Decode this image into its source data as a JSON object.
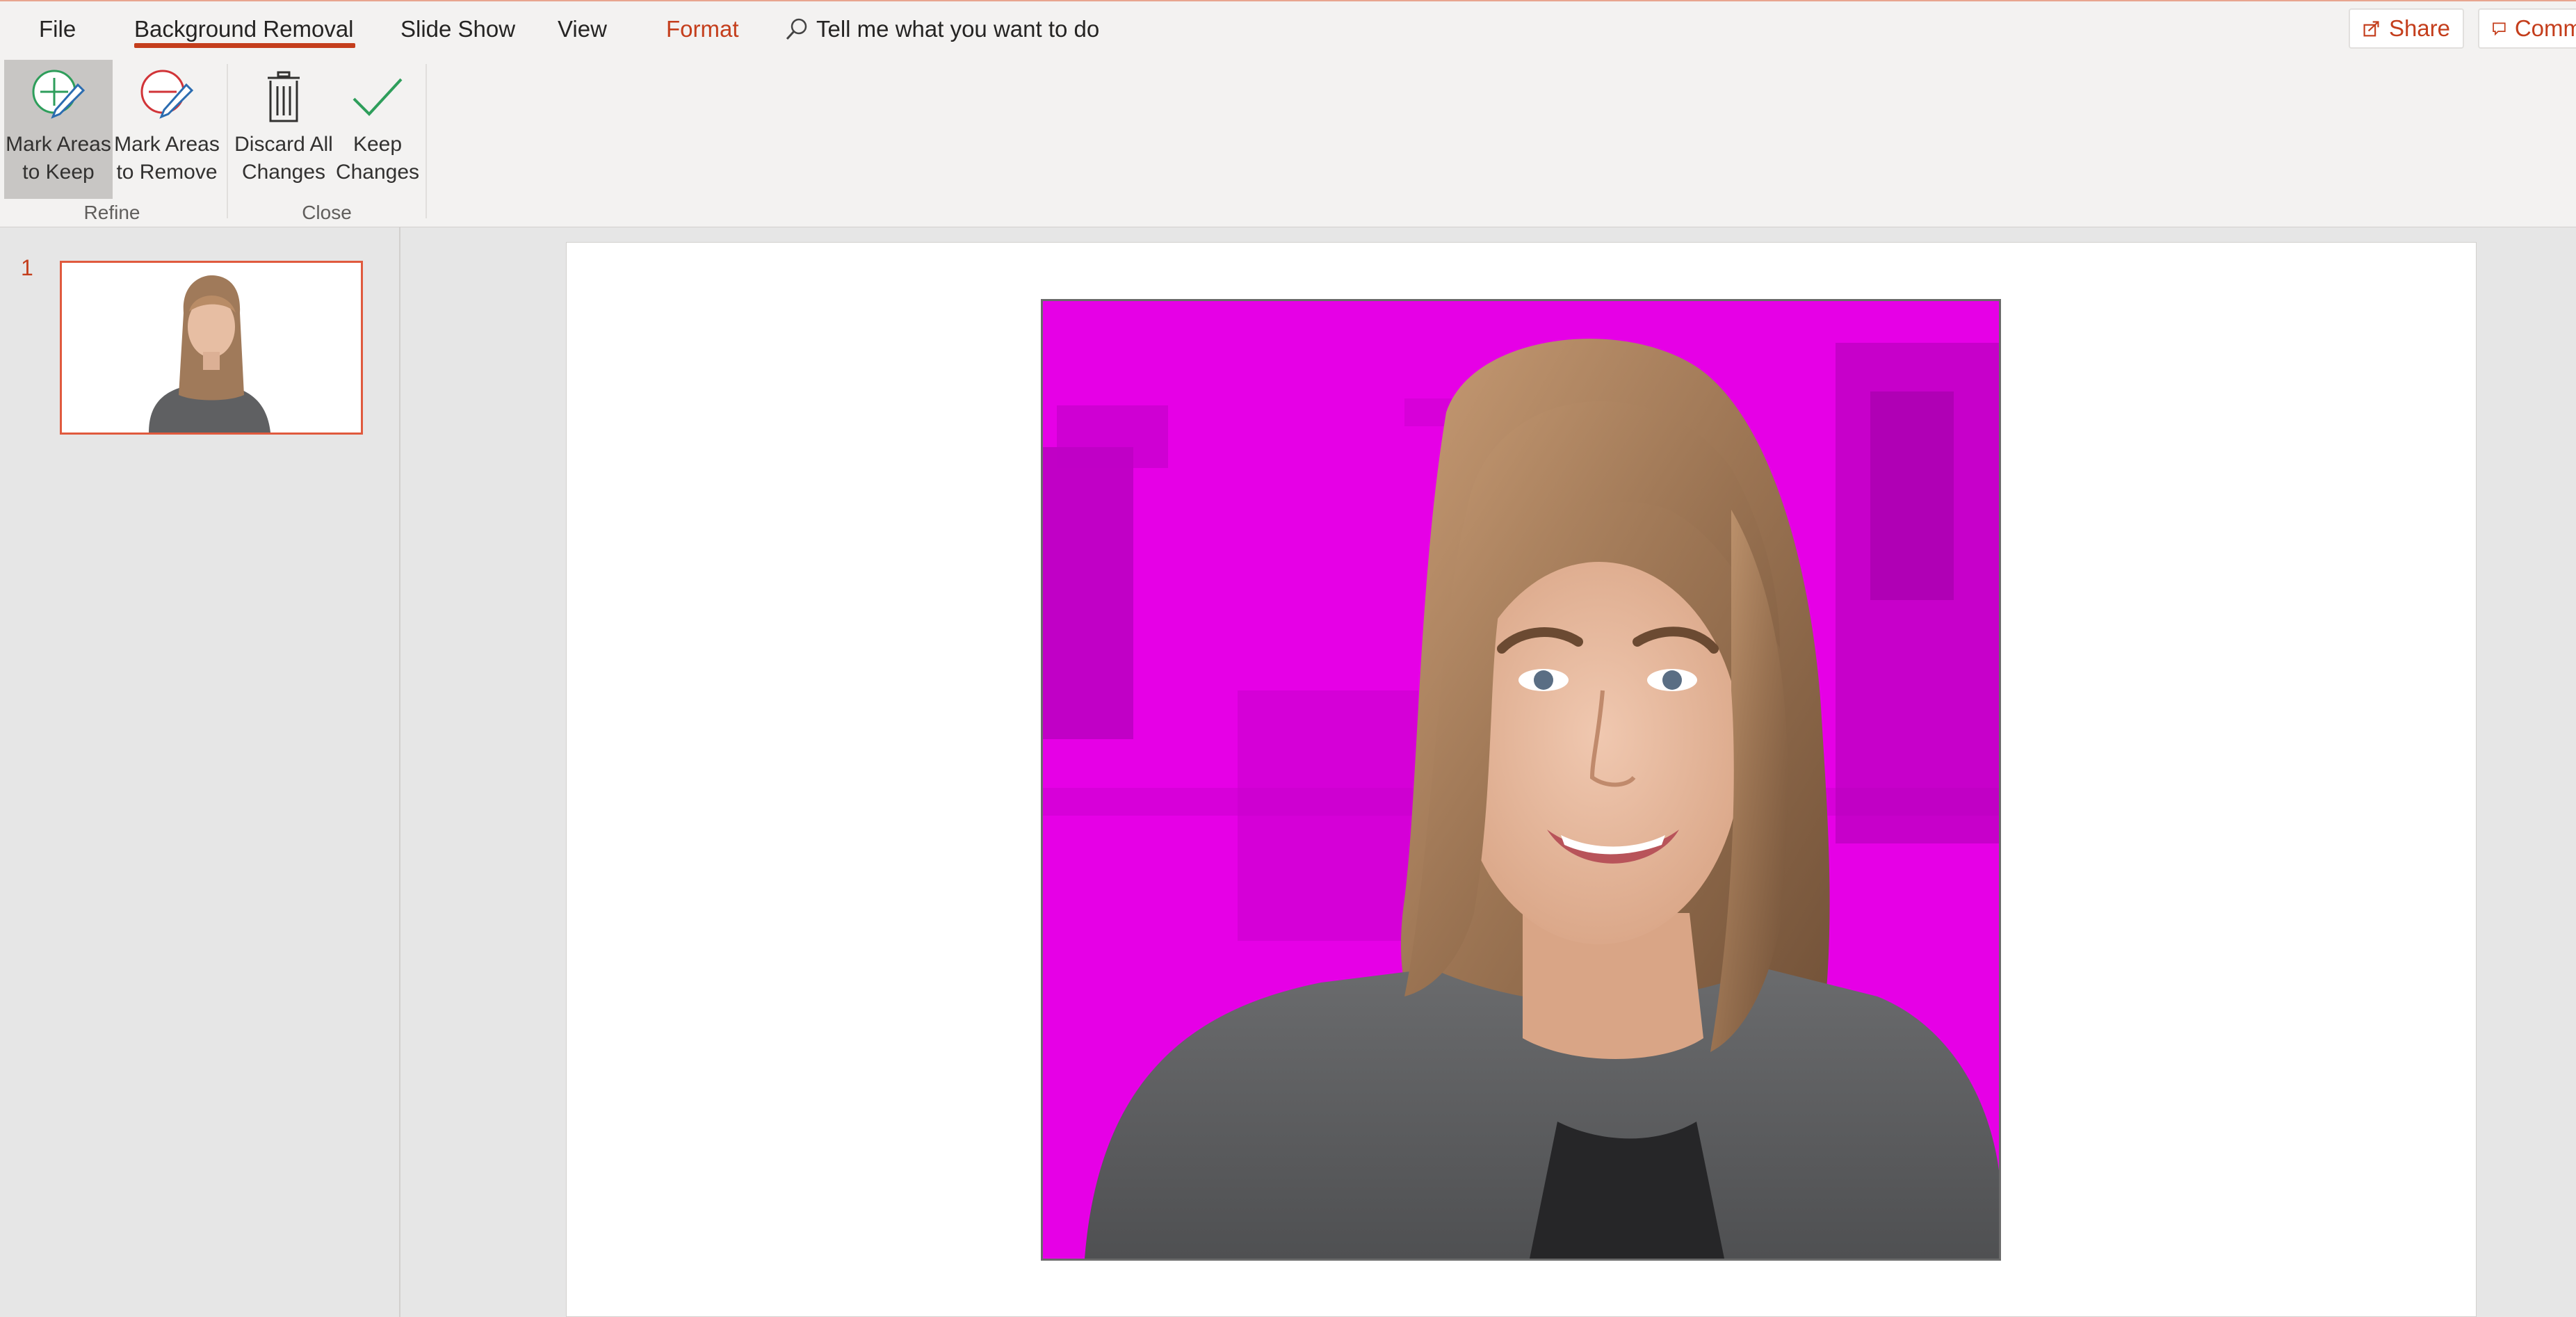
{
  "tabs": {
    "file": "File",
    "background_removal": "Background Removal",
    "slide_show": "Slide Show",
    "view": "View",
    "format": "Format"
  },
  "tell_me": {
    "placeholder": "Tell me what you want to do"
  },
  "header_actions": {
    "share": "Share",
    "comments": "Comm"
  },
  "ribbon": {
    "refine": {
      "label": "Refine",
      "mark_keep_line1": "Mark Areas",
      "mark_keep_line2": "to Keep",
      "mark_remove_line1": "Mark Areas",
      "mark_remove_line2": "to Remove"
    },
    "close": {
      "label": "Close",
      "discard_line1": "Discard All",
      "discard_line2": "Changes",
      "keep_line1": "Keep",
      "keep_line2": "Changes"
    }
  },
  "thumbnails": {
    "slide_number": "1"
  },
  "colors": {
    "accent": "#c43e1c",
    "removal_overlay": "#ff00ff",
    "ribbon_bg": "#f3f2f1",
    "selected_button": "#c8c6c4"
  }
}
